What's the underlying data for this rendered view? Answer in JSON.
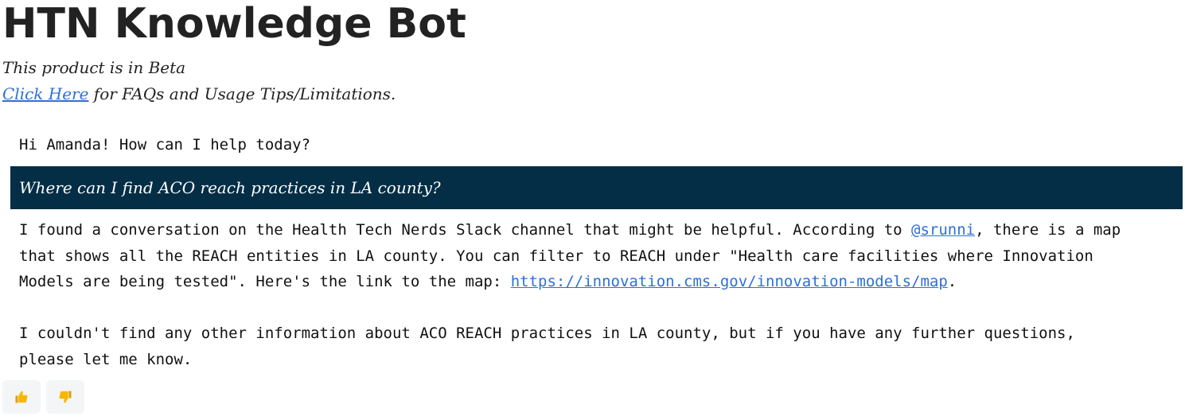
{
  "header": {
    "title": "HTN Knowledge Bot",
    "beta_notice": "This product is in Beta",
    "faq_link_text": "Click Here",
    "faq_suffix": " for FAQs and Usage Tips/Limitations."
  },
  "chat": {
    "greeting": "Hi Amanda! How can I help today?",
    "user_message": "Where can I find ACO reach practices in LA county?",
    "reply": {
      "line1_before": "I found a conversation on the Health Tech Nerds Slack channel that might be helpful. According to ",
      "mention": "@srunni",
      "line1_after": ", there is a map",
      "line2": "that shows all the REACH entities in LA county. You can filter to REACH under \"Health care facilities where Innovation",
      "line3_before": "Models are being tested\". Here's the link to the map: ",
      "map_link": "https://innovation.cms.gov/innovation-models/map",
      "line3_after": ".",
      "line4": "I couldn't find any other information about ACO REACH practices in LA county, but if you have any further questions,",
      "line5": "please let me know."
    }
  },
  "feedback": {
    "thumbs_up_icon": "thumbs-up-icon",
    "thumbs_down_icon": "thumbs-down-icon",
    "icon_color": "#f5b800"
  },
  "colors": {
    "user_bubble": "#032e46",
    "link": "#2f6fd6"
  }
}
